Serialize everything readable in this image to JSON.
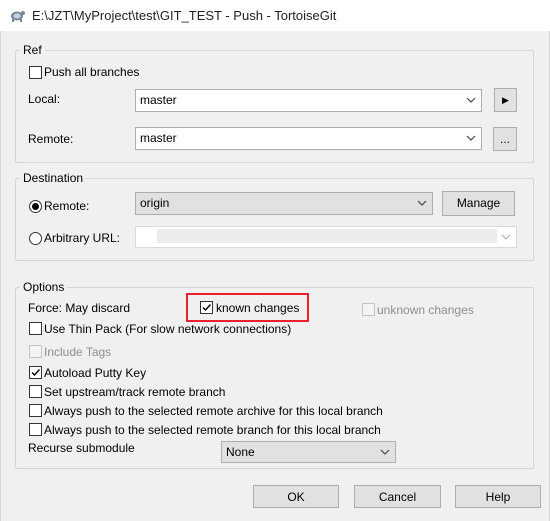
{
  "window": {
    "title": "E:\\JZT\\MyProject\\test\\GIT_TEST - Push - TortoiseGit",
    "icon": "tortoisegit-icon"
  },
  "ref": {
    "legend": "Ref",
    "push_all_label": "Push all branches",
    "push_all_checked": false,
    "local_label": "Local:",
    "local_value": "master",
    "local_button_symbol": "▶",
    "remote_label": "Remote:",
    "remote_value": "master",
    "remote_button_label": "..."
  },
  "destination": {
    "legend": "Destination",
    "remote_radio_label": "Remote:",
    "remote_radio_selected": true,
    "remote_value": "origin",
    "manage_label": "Manage",
    "arbitrary_url_label": "Arbitrary URL:",
    "arbitrary_url_value": ""
  },
  "options": {
    "legend": "Options",
    "force_label": "Force: May discard",
    "known_changes_label": "known changes",
    "known_changes_checked": true,
    "unknown_changes_label": "unknown changes",
    "unknown_changes_checked": false,
    "thin_pack_label": "Use Thin Pack (For slow network connections)",
    "include_tags_label": "Include Tags",
    "autoload_label": "Autoload Putty Key",
    "autoload_checked": true,
    "set_upstream_label": "Set upstream/track remote branch",
    "always_push_archive_label": "Always push to the selected remote archive for this local branch",
    "always_push_branch_label": "Always push to the selected remote branch for this local branch",
    "recurse_label": "Recurse submodule",
    "recurse_value": "None"
  },
  "footer": {
    "ok_label": "OK",
    "cancel_label": "Cancel",
    "help_label": "Help"
  },
  "colors": {
    "highlight": "#e8212a",
    "background": "#f0f0f0"
  }
}
